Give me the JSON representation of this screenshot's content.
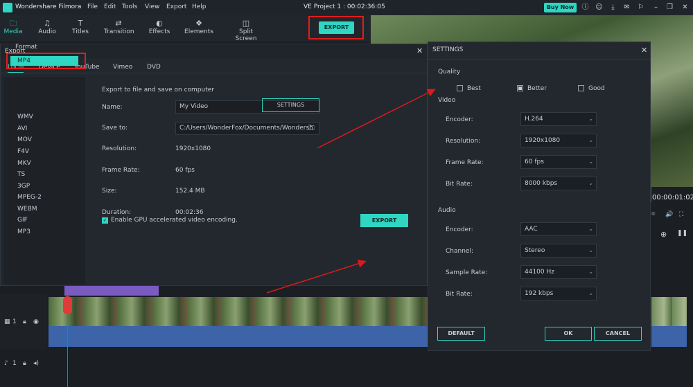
{
  "app": {
    "title": "Wondershare Filmora",
    "project_title": "VE Project 1 : 00:02:36:05",
    "buy_now": "Buy Now",
    "menu": [
      "File",
      "Edit",
      "Tools",
      "View",
      "Export",
      "Help"
    ]
  },
  "toolbar": {
    "items": [
      "Media",
      "Audio",
      "Titles",
      "Transition",
      "Effects",
      "Elements",
      "Split Screen"
    ],
    "export_label": "EXPORT"
  },
  "preview": {
    "timecode": "00:00:01:02"
  },
  "export_dialog": {
    "title": "Export",
    "tabs": [
      "Local",
      "Device",
      "YouTube",
      "Vimeo",
      "DVD"
    ],
    "format_label": "Format",
    "formats": [
      "MP4",
      "WMV",
      "AVI",
      "MOV",
      "F4V",
      "MKV",
      "TS",
      "3GP",
      "MPEG-2",
      "WEBM",
      "GIF",
      "MP3"
    ],
    "heading": "Export to file and save on computer",
    "name_label": "Name:",
    "name_value": "My Video",
    "save_to_label": "Save to:",
    "save_to_value": "C:/Users/WonderFox/Documents/Wondersh",
    "resolution_label": "Resolution:",
    "resolution_value": "1920x1080",
    "settings_button": "SETTINGS",
    "frame_rate_label": "Frame Rate:",
    "frame_rate_value": "60 fps",
    "size_label": "Size:",
    "size_value": "152.4 MB",
    "duration_label": "Duration:",
    "duration_value": "00:02:36",
    "gpu_label": "Enable GPU accelerated video encoding.",
    "gpu_checked": true,
    "export_button": "EXPORT"
  },
  "settings_dialog": {
    "title": "SETTINGS",
    "quality_label": "Quality",
    "quality_options": [
      "Best",
      "Better",
      "Good"
    ],
    "quality_selected": "Better",
    "video_label": "Video",
    "video_encoder_label": "Encoder:",
    "video_encoder": "H.264",
    "video_resolution_label": "Resolution:",
    "video_resolution": "1920x1080",
    "video_frame_rate_label": "Frame Rate:",
    "video_frame_rate": "60 fps",
    "video_bit_rate_label": "Bit Rate:",
    "video_bit_rate": "8000 kbps",
    "audio_label": "Audio",
    "audio_encoder_label": "Encoder:",
    "audio_encoder": "AAC",
    "audio_channel_label": "Channel:",
    "audio_channel": "Stereo",
    "audio_sample_rate_label": "Sample Rate:",
    "audio_sample_rate": "44100 Hz",
    "audio_bit_rate_label": "Bit Rate:",
    "audio_bit_rate": "192 kbps",
    "default_button": "DEFAULT",
    "ok_button": "OK",
    "cancel_button": "CANCEL"
  },
  "timeline": {
    "video_track_num": "1",
    "audio_track_num": "1"
  },
  "colors": {
    "accent": "#2fd6c2",
    "annotation": "#e11d1d",
    "background": "#1b1f24"
  }
}
